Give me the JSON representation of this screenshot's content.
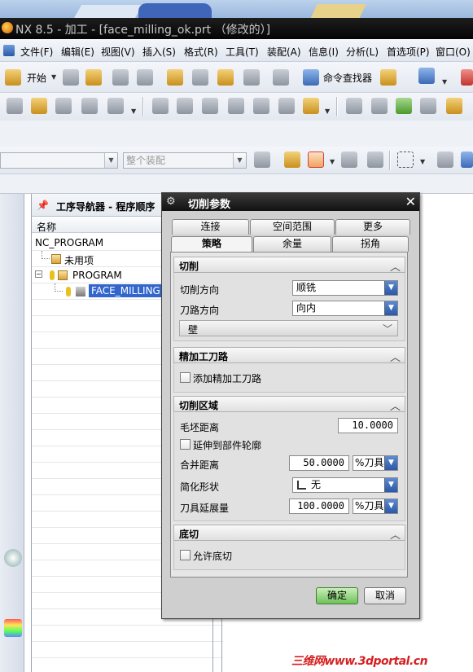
{
  "window": {
    "title": "NX 8.5 - 加工 - [face_milling_ok.prt （修改的）]"
  },
  "menubar": {
    "items": [
      "文件(F)",
      "编辑(E)",
      "视图(V)",
      "插入(S)",
      "格式(R)",
      "工具(T)",
      "装配(A)",
      "信息(I)",
      "分析(L)",
      "首选项(P)",
      "窗口(O)"
    ]
  },
  "toolbar": {
    "start_label": "开始",
    "command_finder_label": "命令查找器",
    "assembly_filter": "整个装配"
  },
  "navigator": {
    "title": "工序导航器 - 程序顺序",
    "column_name": "名称",
    "rows": [
      {
        "label": "NC_PROGRAM"
      },
      {
        "label": "未用项"
      },
      {
        "label": "PROGRAM"
      },
      {
        "label": "FACE_MILLING"
      }
    ]
  },
  "dialog": {
    "title": "切削参数",
    "tabs_row1": [
      "连接",
      "空间范围",
      "更多"
    ],
    "tabs_row2": [
      "策略",
      "余量",
      "拐角"
    ],
    "active_tab": "策略",
    "sections": {
      "cut": {
        "header": "切削",
        "cut_direction_label": "切削方向",
        "cut_direction_value": "顺铣",
        "tool_path_direction_label": "刀路方向",
        "tool_path_direction_value": "向内",
        "wall_label": "壁"
      },
      "finish": {
        "header": "精加工刀路",
        "add_finish_pass_label": "添加精加工刀路",
        "add_finish_pass_checked": false
      },
      "cut_region": {
        "header": "切削区域",
        "blank_distance_label": "毛坯距离",
        "blank_distance_value": "10.0000",
        "extend_to_part_label": "延伸到部件轮廓",
        "extend_to_part_checked": false,
        "merge_distance_label": "合并距离",
        "merge_distance_value": "50.0000",
        "merge_distance_unit": "%刀具",
        "simplify_shape_label": "简化形状",
        "simplify_shape_value": "无",
        "tool_extension_label": "刀具延展量",
        "tool_extension_value": "100.0000",
        "tool_extension_unit": "%刀具"
      },
      "undercut": {
        "header": "底切",
        "allow_undercut_label": "允许底切",
        "allow_undercut_checked": false
      }
    },
    "ok_label": "确定",
    "cancel_label": "取消"
  },
  "watermark": "三维网www.3dportal.cn",
  "colors": {
    "title_bar": "#111111",
    "dialog_bg": "#cfcfcf",
    "ok_button": "#6fc15a",
    "selection": "#3366cc",
    "watermark": "#d62020"
  }
}
